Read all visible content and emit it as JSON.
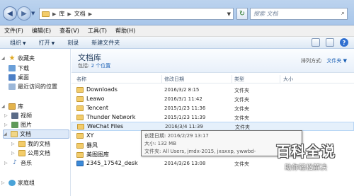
{
  "address": {
    "segments": [
      "库",
      "文档"
    ]
  },
  "search": {
    "placeholder": "搜索 文档"
  },
  "menu": [
    "文件(F)",
    "编辑(E)",
    "查看(V)",
    "工具(T)",
    "帮助(H)"
  ],
  "toolbar": {
    "organize": "组织",
    "open": "打开",
    "burn": "刻录",
    "new_folder": "新建文件夹"
  },
  "nav": {
    "favorites": "收藏夹",
    "downloads": "下载",
    "desktop": "桌面",
    "recent": "最近访问的位置",
    "libraries": "库",
    "videos": "视频",
    "pictures": "图片",
    "documents": "文档",
    "my_documents": "我的文档",
    "public_documents": "公用文档",
    "music": "音乐",
    "homegroup": "家庭组"
  },
  "library": {
    "title": "文档库",
    "includes_label": "包括:",
    "includes_value": "2 个位置",
    "arrange_label": "排列方式:",
    "arrange_value": "文件夹"
  },
  "columns": {
    "name": "名称",
    "date": "修改日期",
    "type": "类型",
    "size": "大小"
  },
  "files": [
    {
      "name": "Downloads",
      "date": "2016/3/2 8:15",
      "type": "文件夹"
    },
    {
      "name": "Leawo",
      "date": "2016/3/1 11:42",
      "type": "文件夹"
    },
    {
      "name": "Tencent",
      "date": "2015/1/23 11:36",
      "type": "文件夹"
    },
    {
      "name": "Thunder Network",
      "date": "2015/1/23 11:39",
      "type": "文件夹"
    },
    {
      "name": "WeChat Files",
      "date": "2016/3/4 11:39",
      "type": "文件夹"
    },
    {
      "name": "XY",
      "date": "",
      "type": ""
    },
    {
      "name": "暴风",
      "date": "",
      "type": ""
    },
    {
      "name": "美图图库",
      "date": "",
      "type": ""
    },
    {
      "name": "2345_17542_desk",
      "date": "2014/3/26 13:08",
      "type": "文件夹"
    }
  ],
  "tooltip": {
    "line1": "创建日期: 2016/2/29 13:17",
    "line2": "大小: 132 MB",
    "line3": "文件夹: All Users, jmdx-2015, jxaxxp, ywwbd-"
  },
  "watermark": {
    "big": "百科全说",
    "small": "助你轻松解决"
  }
}
